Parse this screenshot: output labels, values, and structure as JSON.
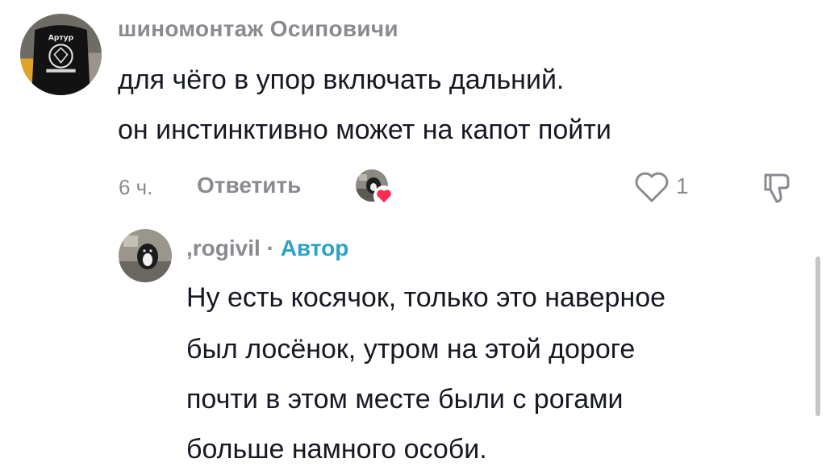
{
  "comment": {
    "username": "шиномонтаж Осиповичи",
    "text_line1": "для чёго в упор включать дальний.",
    "text_line2": "он инстинктивно может на капот пойти",
    "time": "6 ч.",
    "reply_label": "Ответить",
    "like_count": "1",
    "avatar_print": "Артур",
    "icons": {
      "like": "heart-outline-icon",
      "dislike": "thumbs-down-icon",
      "liked_by": "liked-by-creator-heart-icon"
    }
  },
  "reply": {
    "username": ",rogivil",
    "separator": "·",
    "author_badge": "Автор",
    "text_line1": "Ну есть косячок, только это наверное",
    "text_line2": "был лосёнок, утром на этой дороге",
    "text_line3": "почти в этом месте были с рогами",
    "text_line4": "больше намного особи."
  },
  "colors": {
    "text_primary": "#161823",
    "text_secondary": "#8a8b91",
    "author_accent": "#2aa3c7",
    "heart_red": "#fe2c55"
  }
}
